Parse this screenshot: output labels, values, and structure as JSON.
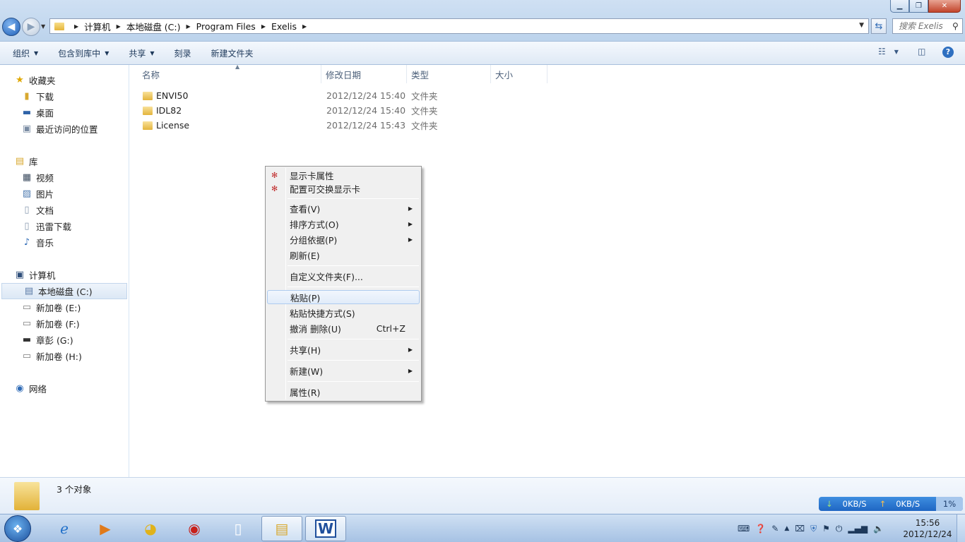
{
  "window": {
    "breadcrumb": [
      "计算机",
      "本地磁盘 (C:)",
      "Program Files",
      "Exelis"
    ],
    "search_placeholder": "搜索 Exelis"
  },
  "toolbar": {
    "organize": "组织",
    "include_in_library": "包含到库中",
    "share": "共享",
    "burn": "刻录",
    "new_folder": "新建文件夹"
  },
  "nav": {
    "favorites": "收藏夹",
    "favorites_items": [
      "下载",
      "桌面",
      "最近访问的位置"
    ],
    "libraries": "库",
    "library_items": [
      "视频",
      "图片",
      "文档",
      "迅雷下载",
      "音乐"
    ],
    "computer": "计算机",
    "computer_items": [
      "本地磁盘 (C:)",
      "新加卷 (E:)",
      "新加卷 (F:)",
      "章彭 (G:)",
      "新加卷 (H:)"
    ],
    "network": "网络"
  },
  "columns": {
    "name": "名称",
    "modified": "修改日期",
    "type": "类型",
    "size": "大小"
  },
  "files": [
    {
      "name": "ENVI50",
      "modified": "2012/12/24 15:40",
      "type": "文件夹"
    },
    {
      "name": "IDL82",
      "modified": "2012/12/24 15:40",
      "type": "文件夹"
    },
    {
      "name": "License",
      "modified": "2012/12/24 15:43",
      "type": "文件夹"
    }
  ],
  "context_menu": {
    "display_props": "显示卡属性",
    "switchable_display": "配置可交换显示卡",
    "view": "查看(V)",
    "sort_by": "排序方式(O)",
    "group_by": "分组依据(P)",
    "refresh": "刷新(E)",
    "customize": "自定义文件夹(F)...",
    "paste": "粘贴(P)",
    "paste_shortcut": "粘贴快捷方式(S)",
    "undo_delete": "撤消 删除(U)",
    "undo_shortcut": "Ctrl+Z",
    "share": "共享(H)",
    "new": "新建(W)",
    "properties": "属性(R)"
  },
  "status": {
    "object_count": "3 个对象"
  },
  "net_widget": {
    "down": "0KB/S",
    "up": "0KB/S",
    "cpu": "1%"
  },
  "clock": {
    "time": "15:56",
    "date": "2012/12/24"
  }
}
